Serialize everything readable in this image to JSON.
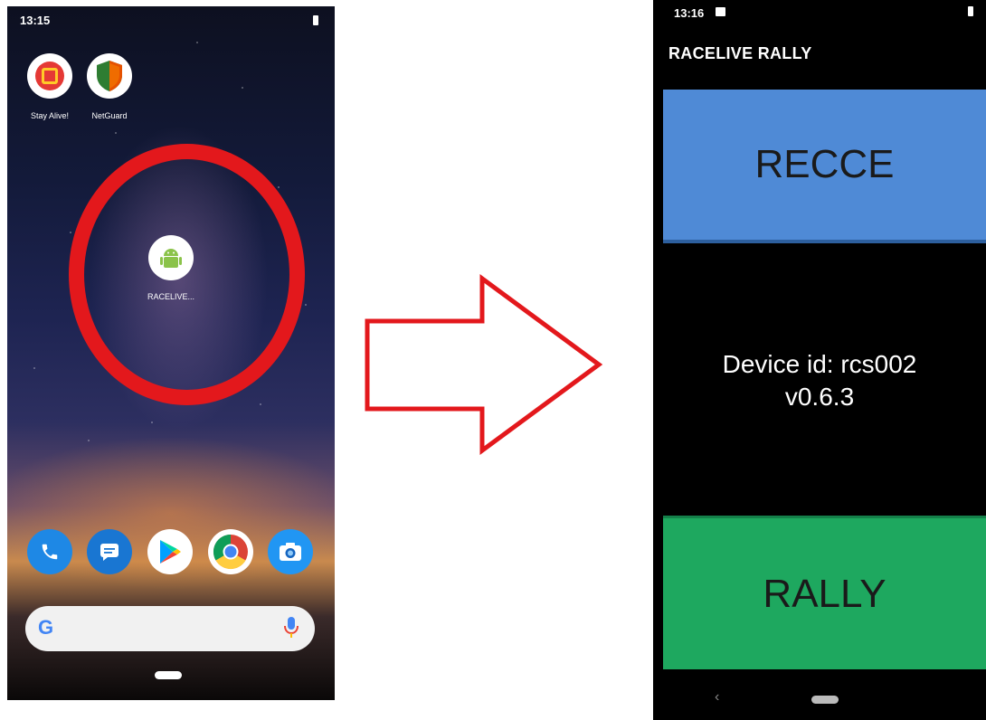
{
  "left_phone": {
    "status_time": "13:15",
    "apps": [
      {
        "label": "Stay Alive!",
        "icon": "stay-alive-icon"
      },
      {
        "label": "NetGuard",
        "icon": "netguard-shield-icon"
      },
      {
        "label": "RACELIVE...",
        "icon": "android-icon"
      }
    ],
    "dock": [
      "phone-icon",
      "messages-icon",
      "play-store-icon",
      "chrome-icon",
      "camera-icon"
    ],
    "search": {
      "logo": "G",
      "icon": "mic-icon"
    }
  },
  "arrow": {
    "icon": "right-arrow-icon",
    "color": "#e3181c"
  },
  "right_phone": {
    "status_time": "13:16",
    "app_title": "RACELIVE RALLY",
    "recce_label": "RECCE",
    "device_id": "Device id: rcs002",
    "version": "v0.6.3",
    "rally_label": "RALLY",
    "back": "‹",
    "colors": {
      "recce": "#4f8ad6",
      "rally": "#1ea85f",
      "background": "#000000"
    }
  }
}
